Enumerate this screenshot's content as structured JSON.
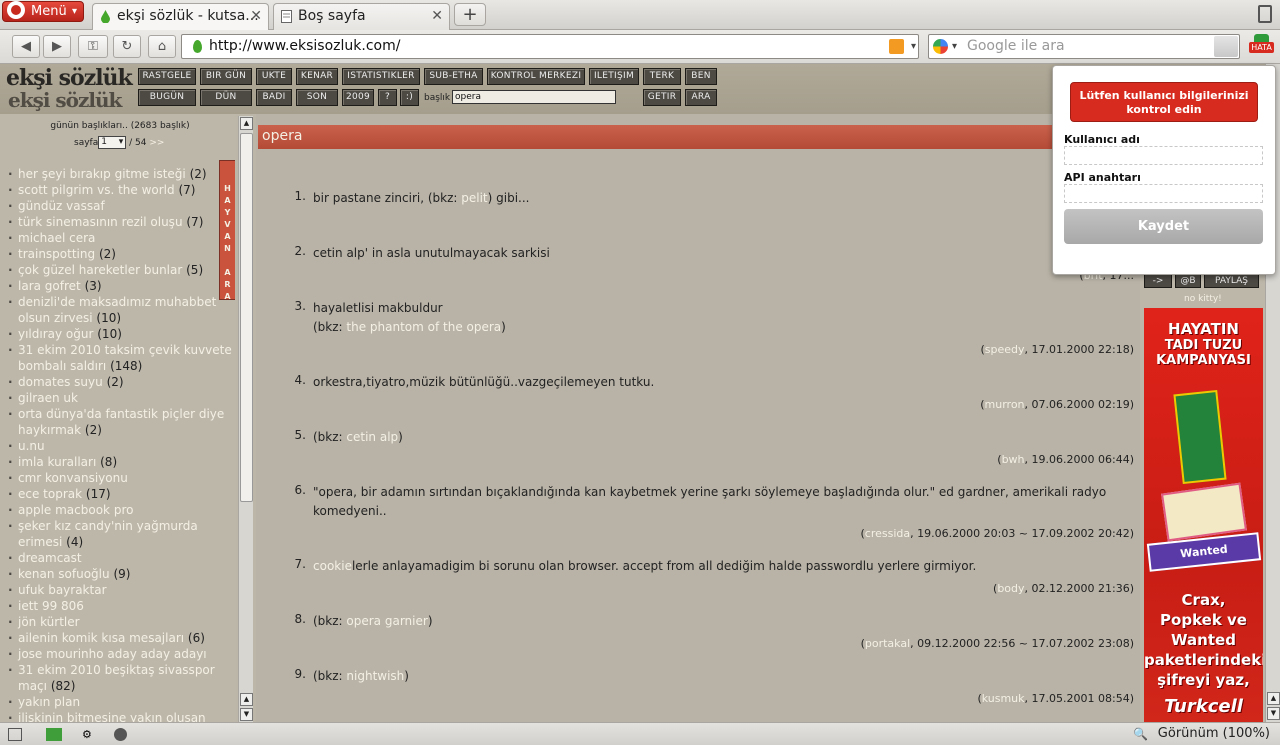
{
  "browser": {
    "menu_label": "Menü",
    "tabs": [
      {
        "title": "ekşi sözlük - kutsa..."
      },
      {
        "title": "Boş sayfa"
      }
    ],
    "url": "http://www.eksisozluk.com/",
    "search_placeholder": "Google ile ara",
    "error_badge": "HATA",
    "zoom_label": "Görünüm (100%)"
  },
  "site": {
    "logo_line1": "ekşi sözlük",
    "logo_line2": "ekşi sözlük",
    "nav_row1": [
      "RASTGELE",
      "BIR GÜN",
      "UKTE",
      "KENAR",
      "ISTATISTIKLER",
      "SUB-ETHA",
      "KONTROL MERKEZI",
      "ILETIŞIM",
      "TERK",
      "BEN"
    ],
    "nav_row2": [
      "BUGÜN",
      "DÜN",
      "BADI",
      "SON",
      "2009",
      "?",
      ":)",
      "GETIR",
      "ARA"
    ],
    "baslik_label": "başlık",
    "baslik_value": "opera"
  },
  "sidebar": {
    "gunun_title": "günün başlıkları.. (2683 başlık)",
    "sayfa_label": "sayfa",
    "sayfa_value": "1",
    "sayfa_total": "/ 54",
    "sayfa_next": ">>",
    "vertical_tab": "HAYVAN ARA",
    "topics": [
      {
        "title": "her şeyi bırakıp gitme isteği",
        "count": "(2)"
      },
      {
        "title": "scott pilgrim vs. the world",
        "count": "(7)"
      },
      {
        "title": "gündüz vassaf",
        "count": ""
      },
      {
        "title": "türk sinemasının rezil oluşu",
        "count": "(7)"
      },
      {
        "title": "michael cera",
        "count": ""
      },
      {
        "title": "trainspotting",
        "count": "(2)"
      },
      {
        "title": "çok güzel hareketler bunlar",
        "count": "(5)"
      },
      {
        "title": "lara gofret",
        "count": "(3)"
      },
      {
        "title": "denizli'de maksadımız muhabbet olsun zirvesi",
        "count": "(10)"
      },
      {
        "title": "yıldıray oğur",
        "count": "(10)"
      },
      {
        "title": "31 ekim 2010 taksim çevik kuvvete bombalı saldırı",
        "count": "(148)"
      },
      {
        "title": "domates suyu",
        "count": "(2)"
      },
      {
        "title": "gilraen uk",
        "count": ""
      },
      {
        "title": "orta dünya'da fantastik piçler diye haykırmak",
        "count": "(2)"
      },
      {
        "title": "u.nu",
        "count": ""
      },
      {
        "title": "imla kuralları",
        "count": "(8)"
      },
      {
        "title": "cmr konvansiyonu",
        "count": ""
      },
      {
        "title": "ece toprak",
        "count": "(17)"
      },
      {
        "title": "apple macbook pro",
        "count": ""
      },
      {
        "title": "şeker kız candy'nin yağmurda erimesi",
        "count": "(4)"
      },
      {
        "title": "dreamcast",
        "count": ""
      },
      {
        "title": "kenan sofuoğlu",
        "count": "(9)"
      },
      {
        "title": "ufuk bayraktar",
        "count": ""
      },
      {
        "title": "iett 99 806",
        "count": ""
      },
      {
        "title": "jön kürtler",
        "count": ""
      },
      {
        "title": "ailenin komik kısa mesajları",
        "count": "(6)"
      },
      {
        "title": "jose mourinho aday aday adayı",
        "count": ""
      },
      {
        "title": "31 ekim 2010 beşiktaş sivasspor maçı",
        "count": "(82)"
      },
      {
        "title": "yakın plan",
        "count": ""
      },
      {
        "title": "ilişkinin bitmesine yakın oluşan",
        "count": ""
      }
    ]
  },
  "content": {
    "topic_title": "opera",
    "entries": [
      {
        "num": "1.",
        "pre": "bir pastane zinciri, (bkz: ",
        "link": "pelit",
        "post": ") gibi...",
        "author": "portakal",
        "date": ", 17..."
      },
      {
        "num": "2.",
        "pre": "cetin alp' in asla unutulmayacak sarkisi",
        "link": "",
        "post": "",
        "author": "brit",
        "date": ", 17..."
      },
      {
        "num": "3.",
        "pre": "hayaletlisi makbuldur",
        "line2_pre": "(bkz: ",
        "link": "the phantom of the opera",
        "post": ")",
        "author": "speedy",
        "date": ", 17.01.2000 22:18)"
      },
      {
        "num": "4.",
        "pre": "orkestra,tiyatro,müzik bütünlüğü..vazgeçilemeyen tutku.",
        "link": "",
        "post": "",
        "author": "murron",
        "date": ", 07.06.2000 02:19)"
      },
      {
        "num": "5.",
        "pre": "(bkz: ",
        "link": "cetin alp",
        "post": ")",
        "author": "bwh",
        "date": ", 19.06.2000 06:44)"
      },
      {
        "num": "6.",
        "pre": "\"opera, bir adamın sırtından bıçaklandığında kan kaybetmek yerine şarkı söylemeye başladığında olur.\" ed gardner, amerikali radyo komedyeni..",
        "link": "",
        "post": "",
        "author": "cressida",
        "date": ", 19.06.2000 20:03 ~ 17.09.2002 20:42)"
      },
      {
        "num": "7.",
        "pre": "",
        "link": "cookie",
        "post": "lerle anlayamadigim bi sorunu olan browser. accept from all dediğim halde passwordlu yerlere girmiyor.",
        "author": "body",
        "date": ", 02.12.2000 21:36)"
      },
      {
        "num": "8.",
        "pre": "(bkz: ",
        "link": "opera garnier",
        "post": ")",
        "author": "portakal",
        "date": ", 09.12.2000 22:56 ~ 17.07.2002 23:08)"
      },
      {
        "num": "9.",
        "pre": "(bkz: ",
        "link": "nightwish",
        "post": ")",
        "author": "kusmuk",
        "date": ", 17.05.2001 08:54)"
      }
    ]
  },
  "right": {
    "btn_arrow": "->",
    "btn_at": "@B",
    "btn_share": "PAYLAŞ",
    "nokitty": "no kitty!",
    "ad": {
      "headline1": "HAYATIN",
      "headline2": "TADI TUZU",
      "headline3": "KAMPANYASI",
      "product_label": "Wanted",
      "body1": "Crax,",
      "body2": "Popkek ve",
      "body3": "Wanted",
      "body4": "paketlerindeki",
      "body5": "şifreyi yaz,",
      "brand": "Turkcell"
    }
  },
  "popup": {
    "error": "Lütfen kullanıcı bilgilerinizi kontrol edin",
    "username_label": "Kullanıcı adı",
    "apikey_label": "API anahtarı",
    "save_label": "Kaydet"
  },
  "colors": {
    "accent_red": "#d72b1f",
    "link_cream": "#f4f0e4",
    "page_bg": "#bcb6a9"
  }
}
